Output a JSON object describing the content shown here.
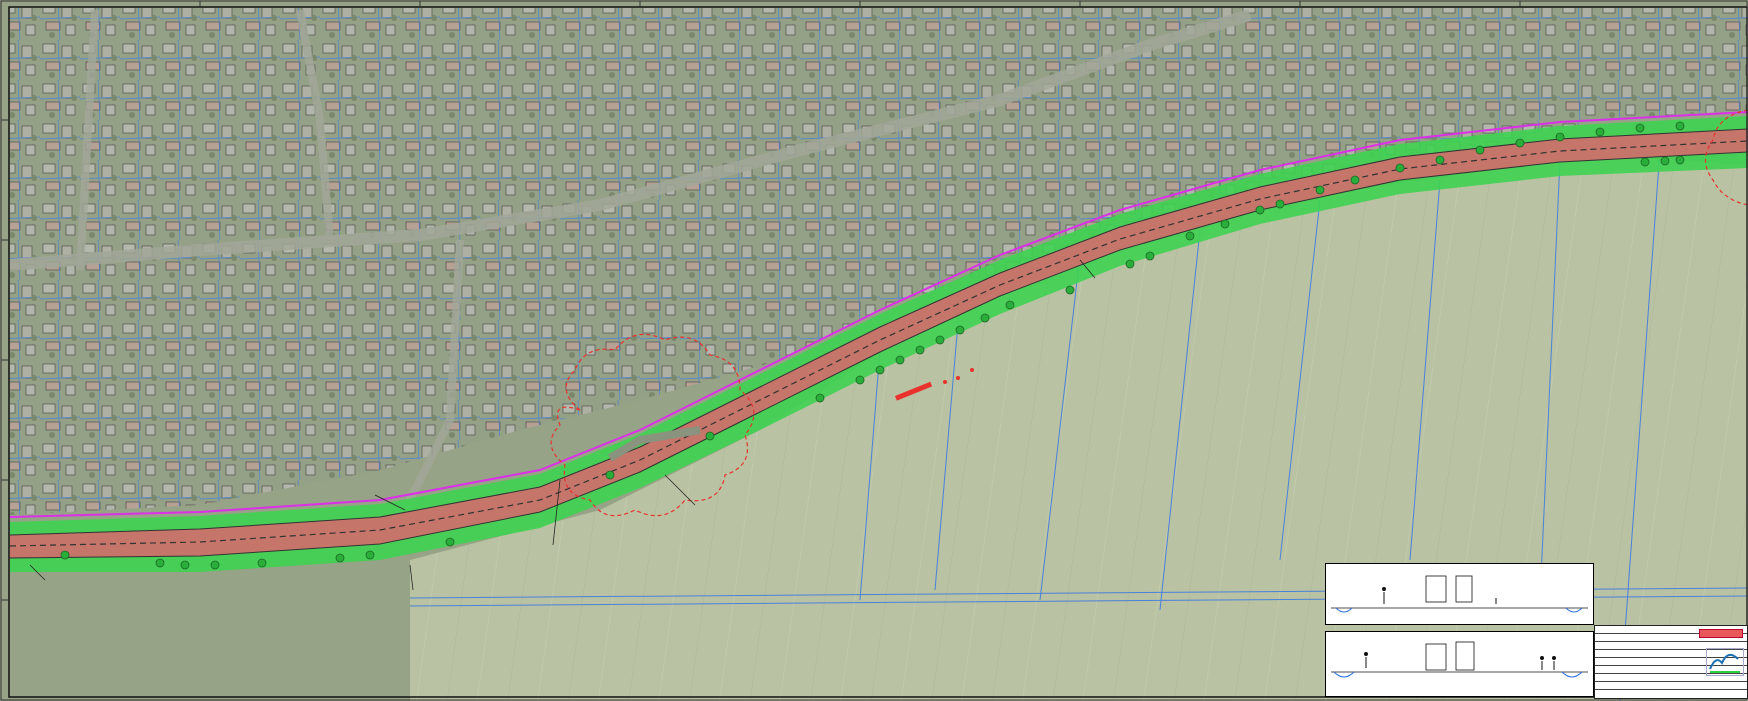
{
  "map": {
    "background_color": "#8f9c7c",
    "field_color": "#b5bf9c",
    "road_color": "#c06a5e",
    "verge_color": "#2fcf42",
    "boundary_color": "#d81fe6",
    "parcel_color": "#2a6fe0",
    "cloud_color": "#e8201c",
    "tree_color": "#18a82a"
  },
  "drawing": {
    "sheet_border_color": "#111111"
  },
  "cross_sections": {
    "section_1_caption": "",
    "section_2_caption": ""
  },
  "title_block": {
    "badge_color": "#e8585a",
    "rows": [
      "",
      "",
      "",
      "",
      "",
      "",
      "",
      ""
    ],
    "logo_name": ""
  }
}
